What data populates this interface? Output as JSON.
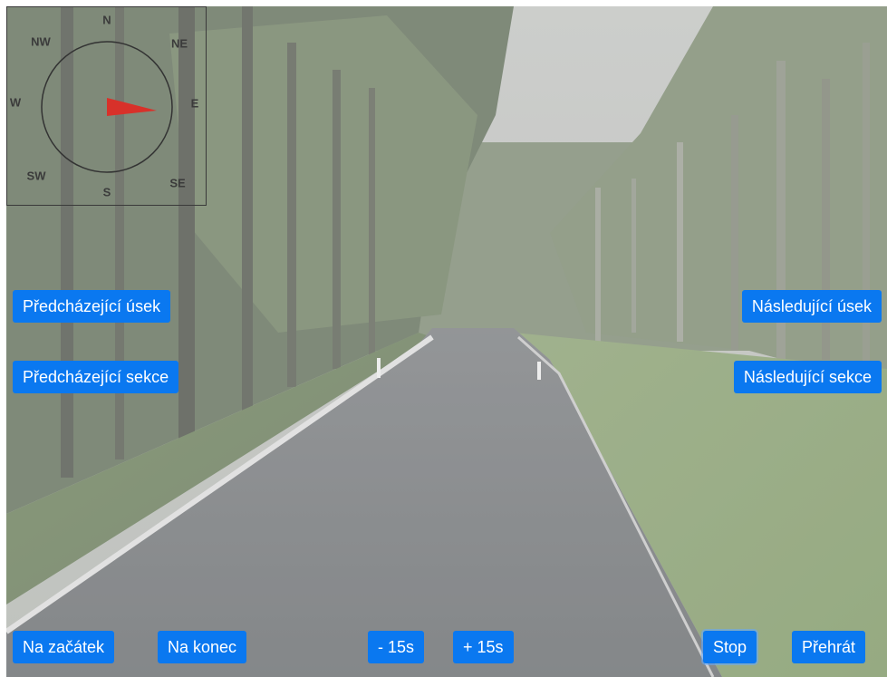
{
  "compass": {
    "directions": {
      "n": "N",
      "ne": "NE",
      "e": "E",
      "se": "SE",
      "s": "S",
      "sw": "SW",
      "w": "W",
      "nw": "NW"
    },
    "needle_color": "#d8312a",
    "heading_label": "E"
  },
  "navigation": {
    "prev_segment": "Předcházející úsek",
    "prev_section": "Předcházející sekce",
    "next_segment": "Následující úsek",
    "next_section": "Následující sekce"
  },
  "controls": {
    "to_start": "Na začátek",
    "to_end": "Na konec",
    "back_15": "- 15s",
    "forward_15": "+ 15s",
    "stop": "Stop",
    "play": "Přehrát"
  },
  "colors": {
    "button_bg": "#0a78f0",
    "button_text": "#ffffff"
  }
}
